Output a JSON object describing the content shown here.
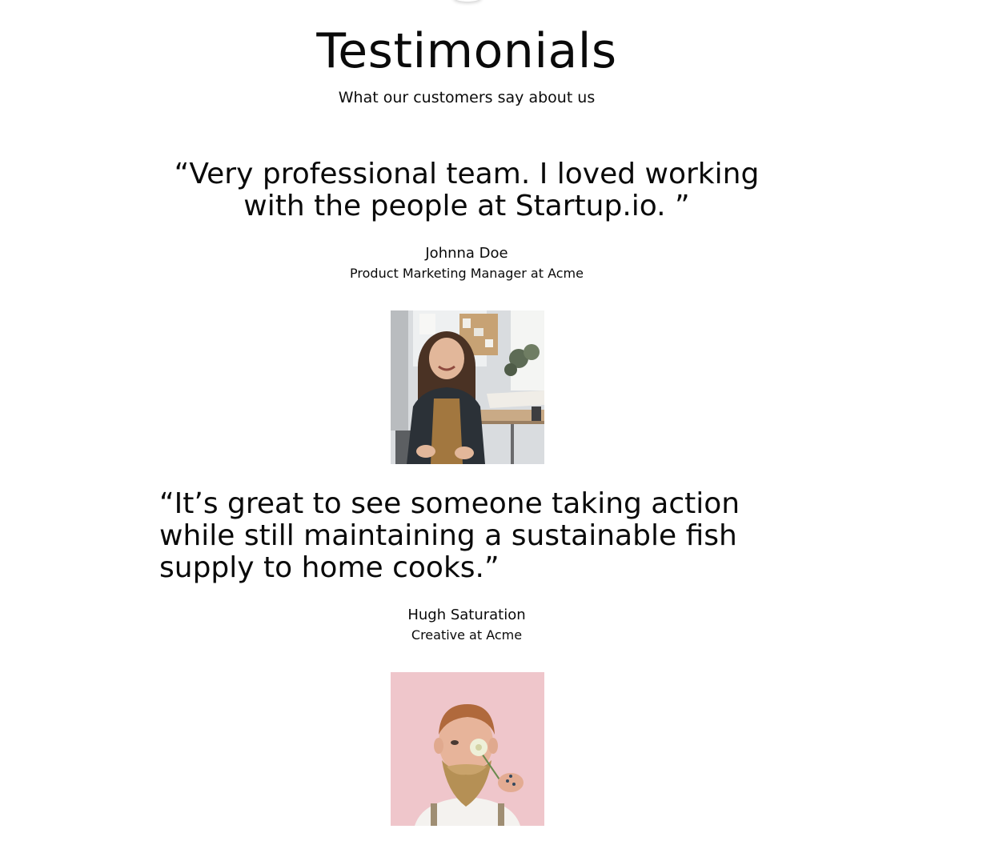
{
  "section": {
    "title": "Testimonials",
    "subtitle": "What our customers say about us"
  },
  "testimonials": [
    {
      "quote": "“Very professional team. I loved working with the people at Startup.io. ”",
      "name": "Johnna Doe",
      "role": "Product Marketing Manager at Acme"
    },
    {
      "quote": "“It’s great to see someone taking action while still maintaining a sustainable fish supply to home cooks.”",
      "name": "Hugh Saturation",
      "role": "Creative at Acme"
    }
  ],
  "colors": {
    "text": "#0a0a0a",
    "background": "#ffffff",
    "photo2_background": "#efc6cb"
  }
}
